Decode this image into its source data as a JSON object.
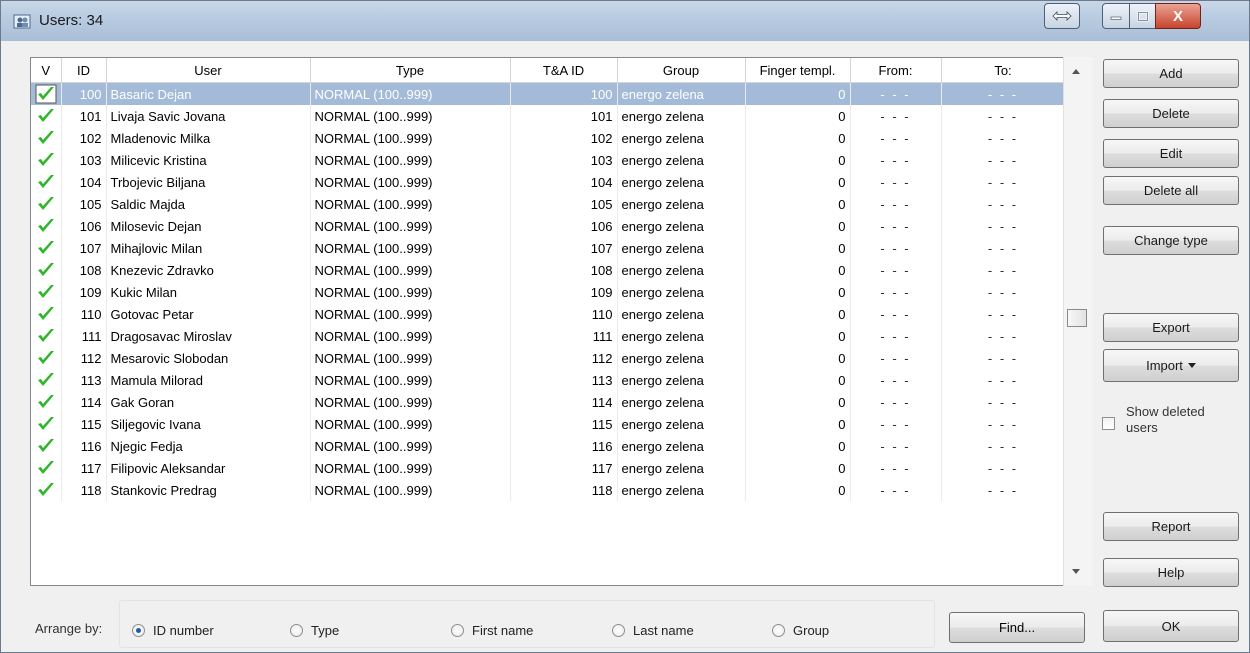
{
  "window": {
    "title": "Users: 34",
    "close_glyph": "X"
  },
  "table": {
    "columns": [
      "V",
      "ID",
      "User",
      "Type",
      "T&A ID",
      "Group",
      "Finger templ.",
      "From:",
      "To:"
    ],
    "rows": [
      {
        "id": "100",
        "user": "Basaric Dejan",
        "type": "NORMAL (100..999)",
        "ta_id": "100",
        "group": "energo zelena",
        "finger": "0",
        "from": "- - -",
        "to": "- - -",
        "selected": true
      },
      {
        "id": "101",
        "user": "Livaja Savic Jovana",
        "type": "NORMAL (100..999)",
        "ta_id": "101",
        "group": "energo zelena",
        "finger": "0",
        "from": "- - -",
        "to": "- - -"
      },
      {
        "id": "102",
        "user": "Mladenovic Milka",
        "type": "NORMAL (100..999)",
        "ta_id": "102",
        "group": "energo zelena",
        "finger": "0",
        "from": "- - -",
        "to": "- - -"
      },
      {
        "id": "103",
        "user": "Milicevic Kristina",
        "type": "NORMAL (100..999)",
        "ta_id": "103",
        "group": "energo zelena",
        "finger": "0",
        "from": "- - -",
        "to": "- - -"
      },
      {
        "id": "104",
        "user": "Trbojevic Biljana",
        "type": "NORMAL (100..999)",
        "ta_id": "104",
        "group": "energo zelena",
        "finger": "0",
        "from": "- - -",
        "to": "- - -"
      },
      {
        "id": "105",
        "user": "Saldic Majda",
        "type": "NORMAL (100..999)",
        "ta_id": "105",
        "group": "energo zelena",
        "finger": "0",
        "from": "- - -",
        "to": "- - -"
      },
      {
        "id": "106",
        "user": "Milosevic Dejan",
        "type": "NORMAL (100..999)",
        "ta_id": "106",
        "group": "energo zelena",
        "finger": "0",
        "from": "- - -",
        "to": "- - -"
      },
      {
        "id": "107",
        "user": "Mihajlovic Milan",
        "type": "NORMAL (100..999)",
        "ta_id": "107",
        "group": "energo zelena",
        "finger": "0",
        "from": "- - -",
        "to": "- - -"
      },
      {
        "id": "108",
        "user": "Knezevic Zdravko",
        "type": "NORMAL (100..999)",
        "ta_id": "108",
        "group": "energo zelena",
        "finger": "0",
        "from": "- - -",
        "to": "- - -"
      },
      {
        "id": "109",
        "user": "Kukic Milan",
        "type": "NORMAL (100..999)",
        "ta_id": "109",
        "group": "energo zelena",
        "finger": "0",
        "from": "- - -",
        "to": "- - -"
      },
      {
        "id": "110",
        "user": "Gotovac Petar",
        "type": "NORMAL (100..999)",
        "ta_id": "110",
        "group": "energo zelena",
        "finger": "0",
        "from": "- - -",
        "to": "- - -"
      },
      {
        "id": "111",
        "user": "Dragosavac Miroslav",
        "type": "NORMAL (100..999)",
        "ta_id": "111",
        "group": "energo zelena",
        "finger": "0",
        "from": "- - -",
        "to": "- - -"
      },
      {
        "id": "112",
        "user": "Mesarovic Slobodan",
        "type": "NORMAL (100..999)",
        "ta_id": "112",
        "group": "energo zelena",
        "finger": "0",
        "from": "- - -",
        "to": "- - -"
      },
      {
        "id": "113",
        "user": "Mamula Milorad",
        "type": "NORMAL (100..999)",
        "ta_id": "113",
        "group": "energo zelena",
        "finger": "0",
        "from": "- - -",
        "to": "- - -"
      },
      {
        "id": "114",
        "user": "Gak Goran",
        "type": "NORMAL (100..999)",
        "ta_id": "114",
        "group": "energo zelena",
        "finger": "0",
        "from": "- - -",
        "to": "- - -"
      },
      {
        "id": "115",
        "user": "Siljegovic Ivana",
        "type": "NORMAL (100..999)",
        "ta_id": "115",
        "group": "energo zelena",
        "finger": "0",
        "from": "- - -",
        "to": "- - -"
      },
      {
        "id": "116",
        "user": "Njegic Fedja",
        "type": "NORMAL (100..999)",
        "ta_id": "116",
        "group": "energo zelena",
        "finger": "0",
        "from": "- - -",
        "to": "- - -"
      },
      {
        "id": "117",
        "user": "Filipovic Aleksandar",
        "type": "NORMAL (100..999)",
        "ta_id": "117",
        "group": "energo zelena",
        "finger": "0",
        "from": "- - -",
        "to": "- - -"
      },
      {
        "id": "118",
        "user": "Stankovic Predrag",
        "type": "NORMAL (100..999)",
        "ta_id": "118",
        "group": "energo zelena",
        "finger": "0",
        "from": "- - -",
        "to": "- - -"
      }
    ]
  },
  "buttons": {
    "add": "Add",
    "delete": "Delete",
    "edit": "Edit",
    "delete_all": "Delete all",
    "change_type": "Change type",
    "export": "Export",
    "import": "Import",
    "report": "Report",
    "help": "Help",
    "ok": "OK",
    "find": "Find..."
  },
  "show_deleted": {
    "label": "Show deleted users",
    "checked": false
  },
  "arrange": {
    "label": "Arrange by:",
    "options": [
      "ID number",
      "Type",
      "First name",
      "Last name",
      "Group"
    ],
    "selected": "ID number"
  },
  "colors": {
    "selection": "#a3bbd8",
    "check": "#2fb52a",
    "titlebar": "#b8cbe1",
    "close_button": "#c9442d"
  },
  "icons": {
    "row_status": "green-checkmark-icon",
    "app": "users-icon"
  }
}
